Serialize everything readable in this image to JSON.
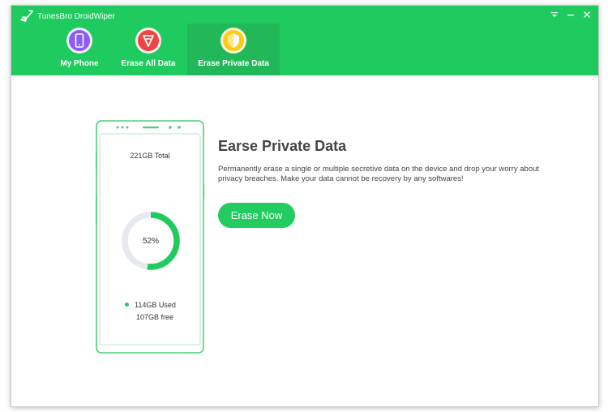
{
  "app": {
    "title": "TunesBro DroidWiper",
    "accent_color": "#1fcb5f"
  },
  "window_controls": [
    {
      "name": "menu-icon",
      "glyph": "menu"
    },
    {
      "name": "minimize-icon",
      "glyph": "minimize"
    },
    {
      "name": "close-icon",
      "glyph": "close"
    }
  ],
  "tabs": [
    {
      "label": "My Phone",
      "icon": "phone-icon",
      "icon_color": "#8b5cf6",
      "active": false
    },
    {
      "label": "Erase All Data",
      "icon": "erase-all-icon",
      "icon_color": "#ef4444",
      "active": false
    },
    {
      "label": "Erase Private Data",
      "icon": "shield-icon",
      "icon_color": "#facc15",
      "active": true
    }
  ],
  "storage": {
    "total": "221GB Total",
    "percent_used": 52,
    "percent_label": "52%",
    "used": "114GB Used",
    "free": "107GB free"
  },
  "content": {
    "heading": "Earse Private Data",
    "description": "Permanently erase a single or multiple secretive data on the device and drop your worry about privacy breaches. Make your data cannot be recovery by any softwares!",
    "button_label": "Erase Now"
  }
}
